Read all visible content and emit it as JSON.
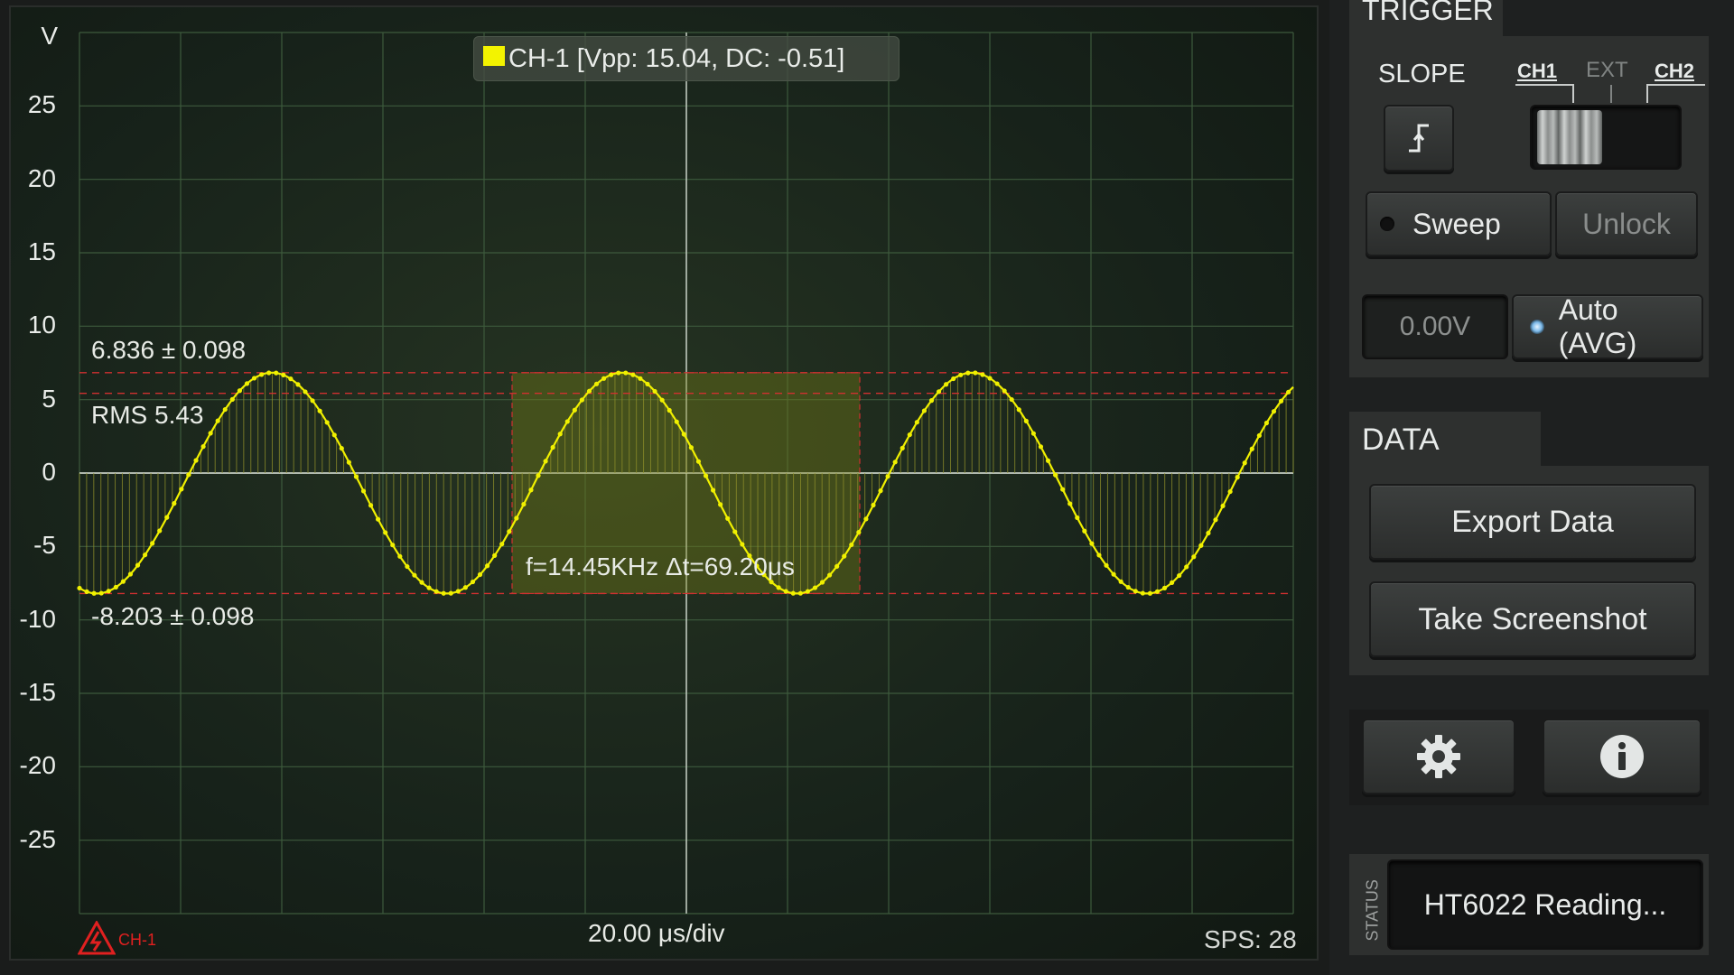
{
  "scope": {
    "y_unit": "V",
    "y_ticks": [
      "25",
      "20",
      "15",
      "10",
      "5",
      "0",
      "-5",
      "-10",
      "-15",
      "-20",
      "-25"
    ],
    "channel_label": "CH-1 [Vpp: 15.04, DC: -0.51]",
    "max_measure": "6.836 ± 0.098",
    "rms_measure": "RMS 5.43",
    "min_measure": "-8.203 ± 0.098",
    "freq_measure": "f=14.45KHz Δt=69.20μs",
    "timebase": "20.00 μs/div",
    "sps": "SPS: 28",
    "warning_channel": "CH-1",
    "colors": {
      "trace": "#f0f000",
      "grid": "#3d5a3c",
      "marker": "#d03030"
    }
  },
  "chart_data": {
    "type": "line",
    "xlabel": "20.00 μs/div",
    "ylabel": "V",
    "ylim": [
      -30,
      30
    ],
    "x_divisions": 12,
    "y_divisions": 12,
    "series": [
      {
        "name": "CH-1",
        "frequency_khz": 14.45,
        "max": 6.836,
        "min": -8.203,
        "dc": -0.51,
        "vpp": 15.04,
        "rms": 5.43
      }
    ]
  },
  "trigger": {
    "title": "TRIGGER",
    "slope_label": "SLOPE",
    "source_ch1": "CH1",
    "source_ext": "EXT",
    "source_ch2": "CH2",
    "sweep_label": "Sweep",
    "unlock_label": "Unlock",
    "level_value": "0.00V",
    "auto_label": "Auto (AVG)"
  },
  "data_panel": {
    "title": "DATA",
    "export_label": "Export Data",
    "screenshot_label": "Take Screenshot"
  },
  "status": {
    "label": "STATUS",
    "text": "HT6022 Reading..."
  }
}
